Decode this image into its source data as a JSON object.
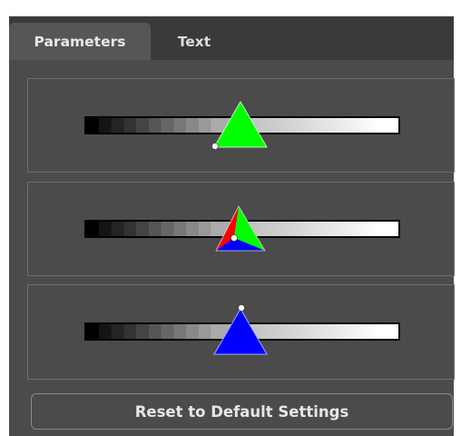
{
  "tabs": [
    {
      "label": "Parameters",
      "active": true
    },
    {
      "label": "Text",
      "active": false
    }
  ],
  "sliders": [
    {
      "name": "slider-1",
      "handles": [
        "green-triangle"
      ],
      "point_level": 0.41,
      "handle_level": 0.5
    },
    {
      "name": "slider-2",
      "handles": [
        "red-triangle",
        "green-triangle",
        "blue-triangle"
      ],
      "point_level": 0.47,
      "handle_level": 0.5
    },
    {
      "name": "slider-3",
      "handles": [
        "blue-triangle"
      ],
      "point_level": 0.5,
      "handle_level": 0.5
    }
  ],
  "reset_button": {
    "label": "Reset to Default Settings"
  },
  "colors": {
    "panel_bg": "#4b4b4b",
    "tabbar_bg": "#3a3a3a",
    "active_tab": "#565656",
    "green": "#00ff00",
    "red": "#ff0000",
    "blue": "#0000ff",
    "border": "#6e6e6e"
  }
}
